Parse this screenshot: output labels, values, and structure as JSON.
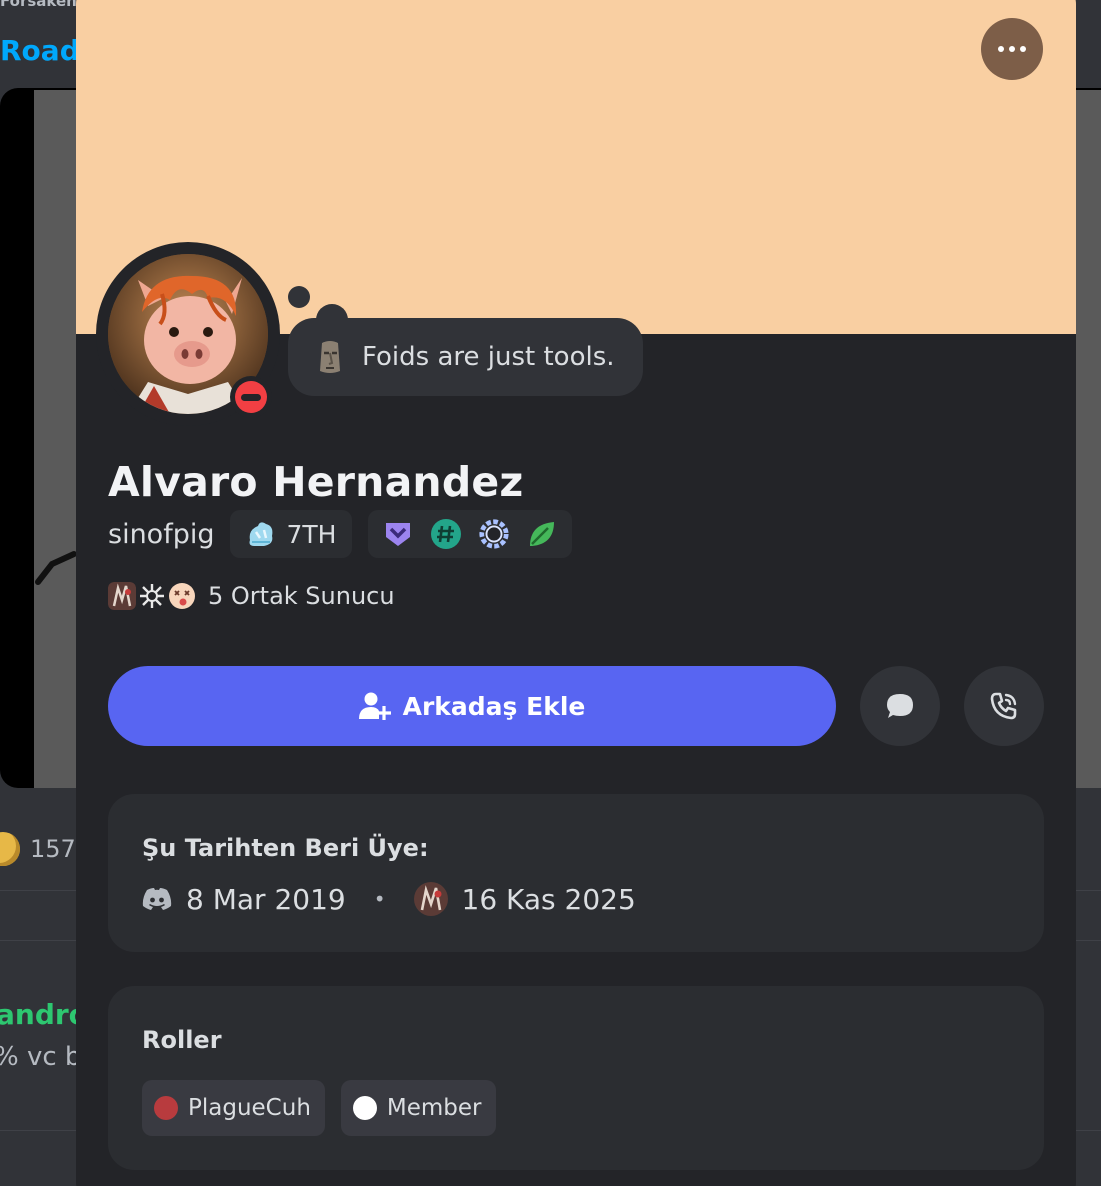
{
  "background": {
    "top_text": "Forsaken",
    "link_text": "Roadm",
    "reaction_count": "157",
    "user_name": "andro",
    "message_snippet": "% vc b"
  },
  "profile": {
    "banner_color": "#f9cfa2",
    "more_button_icon": "ellipsis-icon",
    "status": "do-not-disturb",
    "custom_status": "Foids are just tools.",
    "custom_status_emoji": "moai",
    "display_name": "Alvaro Hernandez",
    "username": "sinofpig",
    "guild_tag": "7TH",
    "badges": [
      "hypesquad-balance",
      "hashtag",
      "quest-ring",
      "leaf"
    ],
    "mutual_servers_text": "5 Ortak Sunucu",
    "add_friend_label": "Arkadaş Ekle",
    "accent_color": "#5865f2"
  },
  "member_since": {
    "title": "Şu Tarihten Beri Üye:",
    "discord_date": "8 Mar 2019",
    "server_date": "16 Kas 2025"
  },
  "roles": {
    "title": "Roller",
    "items": [
      {
        "name": "PlagueCuh",
        "color": "#b83b3e"
      },
      {
        "name": "Member",
        "color": "#ffffff"
      }
    ]
  }
}
